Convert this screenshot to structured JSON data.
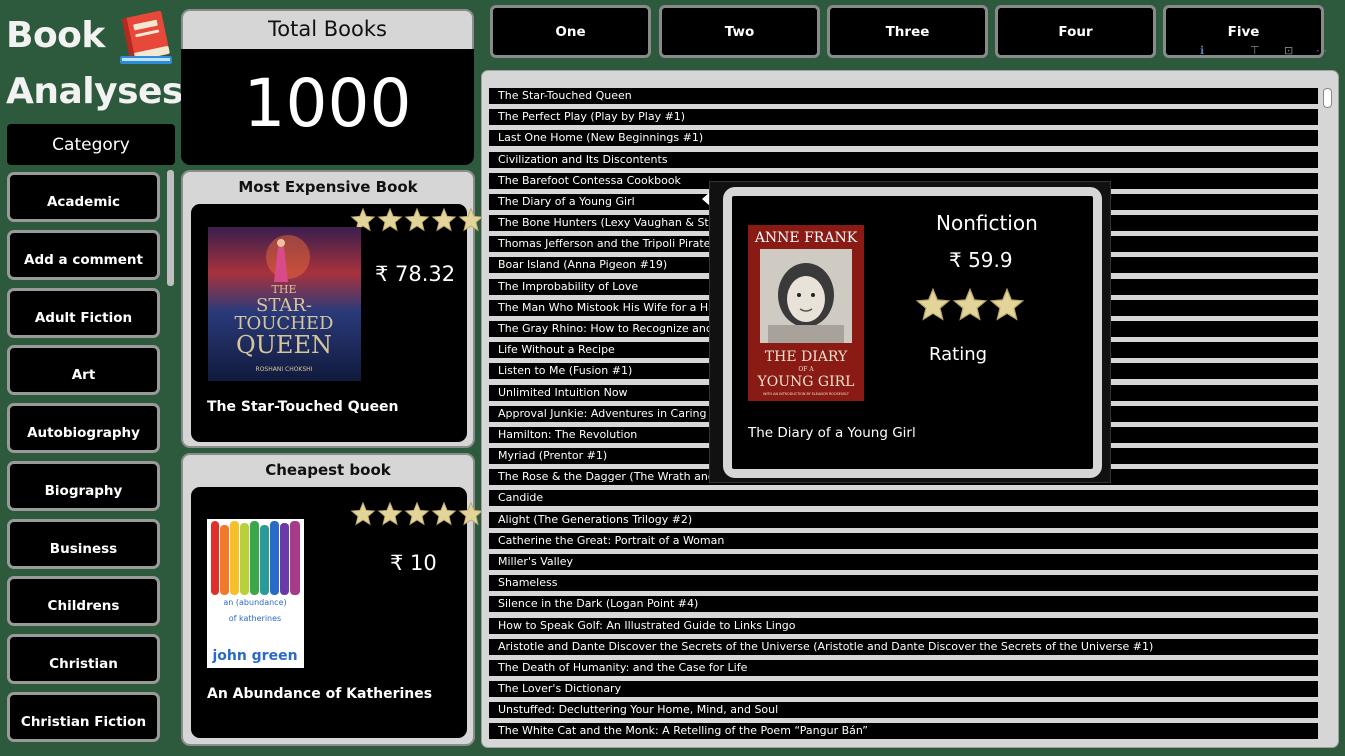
{
  "app": {
    "title_line1": "Book",
    "title_line2": "Analyses"
  },
  "sidebar": {
    "header": "Category",
    "categories": [
      "Academic",
      "Add a comment",
      "Adult Fiction",
      "Art",
      "Autobiography",
      "Biography",
      "Business",
      "Childrens",
      "Christian",
      "Christian Fiction"
    ]
  },
  "total_books": {
    "title": "Total Books",
    "value": "1000"
  },
  "most_expensive": {
    "title": "Most Expensive Book",
    "price": "₹ 78.32",
    "book_title": "The Star-Touched Queen",
    "rating": 5,
    "cover_text": {
      "line1": "THE",
      "line2": "STAR-",
      "line3": "TOUCHED",
      "line4": "QUEEN",
      "author": "ROSHANI CHOKSHI"
    }
  },
  "cheapest": {
    "title": "Cheapest book",
    "price": "₹ 10",
    "book_title": "An Abundance of Katherines",
    "rating": 5,
    "cover_text": {
      "line1": "an (abundance)",
      "line2": "of katherines",
      "author": "john green"
    }
  },
  "tabs": [
    "One",
    "Two",
    "Three",
    "Four",
    "Five"
  ],
  "book_list": [
    "The Star-Touched Queen",
    "The Perfect Play (Play by Play #1)",
    "Last One Home (New Beginnings #1)",
    "Civilization and Its Discontents",
    "The Barefoot Contessa Cookbook",
    "The Diary of a Young Girl",
    "The Bone Hunters (Lexy Vaughan & Stev",
    "Thomas Jefferson and the Tripoli Pirate",
    "Boar Island (Anna Pigeon #19)",
    "The Improbability of Love",
    "The Man Who Mistook His Wife for a Ha",
    "The Gray Rhino: How to Recognize and A",
    "Life Without a Recipe",
    "Listen to Me (Fusion #1)",
    "Unlimited Intuition Now",
    "Approval Junkie: Adventures in Caring To",
    "Hamilton: The Revolution",
    "Myriad (Prentor #1)",
    "The Rose & the Dagger (The Wrath and",
    "Candide",
    "Alight (The Generations Trilogy #2)",
    "Catherine the Great: Portrait of a Woman",
    "Miller's Valley",
    "Shameless",
    "Silence in the Dark (Logan Point #4)",
    "How to Speak Golf: An Illustrated Guide to Links Lingo",
    "Aristotle and Dante Discover the Secrets of the Universe (Aristotle and Dante Discover the Secrets of the Universe #1)",
    "The Death of Humanity: and the Case for Life",
    "The Lover's Dictionary",
    "Unstuffed: Decluttering Your Home, Mind, and Soul",
    "The White Cat and the Monk: A Retelling of the Poem “Pangur Bán”"
  ],
  "tooltip": {
    "category": "Nonfiction",
    "price": "₹ 59.9",
    "rating": 3,
    "rating_label": "Rating",
    "book_title": "The Diary of a Young Girl",
    "cover_text": {
      "author": "ANNE FRANK",
      "line1": "THE DIARY",
      "line2": "OF A",
      "line3": "YOUNG GIRL",
      "subtitle": "WITH AN INTRODUCTION BY ELEANOR ROOSEVELT"
    }
  },
  "colors": {
    "background": "#2d5a3c",
    "panel": "#d6d6d6",
    "star": "#e3d49a"
  }
}
